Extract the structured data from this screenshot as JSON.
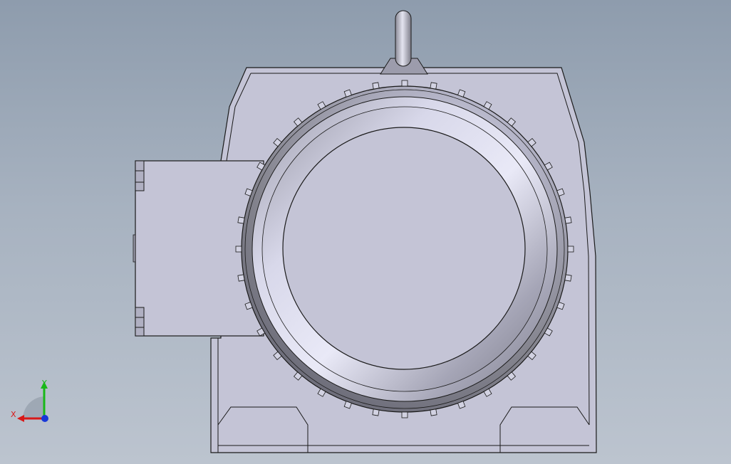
{
  "colors": {
    "background_top": "#8e9cad",
    "background_bottom": "#bcc4cf",
    "part_fill": "#c4c4d6",
    "part_edge": "#1a1a1a",
    "ring_dark": "#6f6f7f",
    "ring_light": "#e6e6f6",
    "axis_x": "#d81818",
    "axis_y": "#18b818",
    "axis_z": "#1838d8"
  },
  "triad": {
    "x_label": "X",
    "y_label": "Y"
  }
}
